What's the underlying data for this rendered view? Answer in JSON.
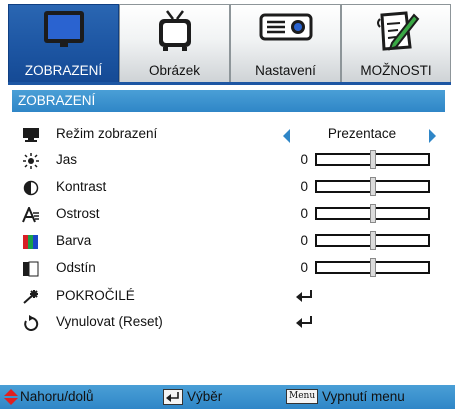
{
  "tabs": [
    {
      "label": "ZOBRAZENÍ",
      "icon": "display-icon",
      "active": true
    },
    {
      "label": "Obrázek",
      "icon": "tv-icon",
      "active": false
    },
    {
      "label": "Nastavení",
      "icon": "projector-icon",
      "active": false
    },
    {
      "label": "MOŽNOSTI",
      "icon": "notepad-pencil-icon",
      "active": false
    }
  ],
  "section": {
    "title": "ZOBRAZENÍ"
  },
  "menu": {
    "mode": {
      "label": "Režim zobrazení",
      "value": "Prezentace",
      "icon": "monitor-icon"
    },
    "sliders": [
      {
        "label": "Jas",
        "value": "0",
        "icon": "sun-icon",
        "level": 0.5
      },
      {
        "label": "Kontrast",
        "value": "0",
        "icon": "contrast-icon",
        "level": 0.5
      },
      {
        "label": "Ostrost",
        "value": "0",
        "icon": "sharpness-icon",
        "level": 0.5
      },
      {
        "label": "Barva",
        "value": "0",
        "icon": "color-icon",
        "level": 0.5
      },
      {
        "label": "Odstín",
        "value": "0",
        "icon": "tint-icon",
        "level": 0.5
      }
    ],
    "advanced": {
      "label": "POKROČILÉ",
      "icon": "advanced-star-icon"
    },
    "reset": {
      "label": "Vynulovat (Reset)",
      "icon": "reset-icon"
    }
  },
  "bottom_bar": {
    "navigate_label": "Nahoru/dolů",
    "select_label": "Výběr",
    "menu_key": "Menu",
    "exit_label": "Vypnutí menu"
  },
  "colors": {
    "active_tab": "#1d56a3",
    "header_bar": "#2f86c7",
    "arrow": "#2f86c7",
    "nav_arrow": "#e02020"
  }
}
